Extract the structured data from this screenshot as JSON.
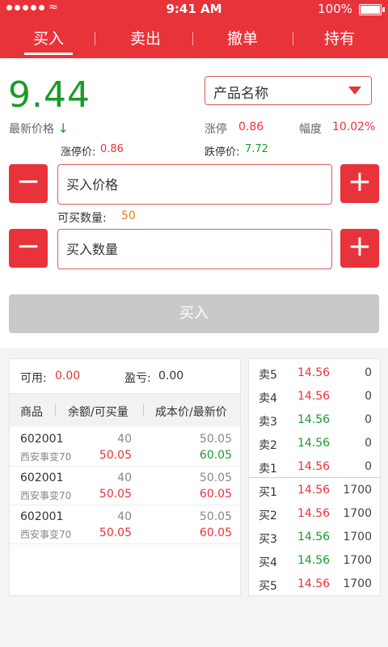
{
  "status_bar": {
    "time": "9:41 AM",
    "battery": "100%"
  },
  "tabs": [
    {
      "label": "买入",
      "active": true
    },
    {
      "label": "卖出",
      "active": false
    },
    {
      "label": "撤单",
      "active": false
    },
    {
      "label": "持有",
      "active": false
    }
  ],
  "quote": {
    "price": "9.44",
    "product_select": "产品名称",
    "latest_label": "最新价格",
    "limit_up_label": "涨停",
    "limit_up_value": "0.86",
    "range_label": "幅度",
    "range_value": "10.02%",
    "limit_up_price_label": "涨停价:",
    "limit_up_price_value": "0.86",
    "limit_down_price_label": "跌停价:",
    "limit_down_price_value": "7.72"
  },
  "order": {
    "price_placeholder": "买入价格",
    "available_qty_label": "可买数量:",
    "available_qty_value": "50",
    "qty_placeholder": "买入数量",
    "submit_label": "买入"
  },
  "account": {
    "available_label": "可用:",
    "available_value": "0.00",
    "pnl_label": "盈亏:",
    "pnl_value": "0.00"
  },
  "holdings": {
    "columns": [
      "商品",
      "余额/可买量",
      "成本价/最新价"
    ],
    "rows": [
      {
        "code": "602001",
        "name": "西安事变70",
        "amount": "40",
        "available": "50.05",
        "cost": "50.05",
        "last": "60.05",
        "last_color": "green"
      },
      {
        "code": "602001",
        "name": "西安事变70",
        "amount": "40",
        "available": "50.05",
        "cost": "50.05",
        "last": "60.05",
        "last_color": "red"
      },
      {
        "code": "602001",
        "name": "西安事变70",
        "amount": "40",
        "available": "50.05",
        "cost": "50.05",
        "last": "60.05",
        "last_color": "red"
      }
    ]
  },
  "order_book": {
    "asks": [
      {
        "label": "卖5",
        "price": "14.56",
        "volume": "0",
        "color": "red"
      },
      {
        "label": "卖4",
        "price": "14.56",
        "volume": "0",
        "color": "red"
      },
      {
        "label": "卖3",
        "price": "14.56",
        "volume": "0",
        "color": "green"
      },
      {
        "label": "卖2",
        "price": "14.56",
        "volume": "0",
        "color": "green"
      },
      {
        "label": "卖1",
        "price": "14.56",
        "volume": "0",
        "color": "red"
      }
    ],
    "bids": [
      {
        "label": "买1",
        "price": "14.56",
        "volume": "1700",
        "color": "red"
      },
      {
        "label": "买2",
        "price": "14.56",
        "volume": "1700",
        "color": "red"
      },
      {
        "label": "买3",
        "price": "14.56",
        "volume": "1700",
        "color": "green"
      },
      {
        "label": "买4",
        "price": "14.56",
        "volume": "1700",
        "color": "green"
      },
      {
        "label": "买5",
        "price": "14.56",
        "volume": "1700",
        "color": "red"
      }
    ]
  },
  "colors": {
    "accent": "#e8333a",
    "up": "#e8333a",
    "down": "#1a9a2a",
    "disabled": "#c9c9c9"
  }
}
